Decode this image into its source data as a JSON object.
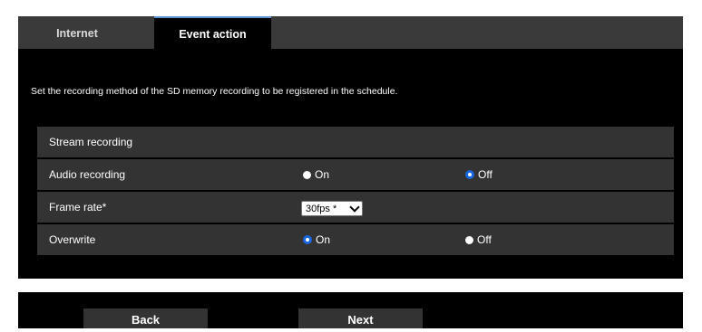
{
  "tabs": [
    {
      "label": "Internet",
      "active": false
    },
    {
      "label": "Event action",
      "active": true
    }
  ],
  "description": "Set the recording method of the SD memory recording to be registered in the schedule.",
  "section_title": "Stream recording",
  "audio_recording": {
    "label": "Audio recording",
    "options": [
      "On",
      "Off"
    ],
    "selected": "Off"
  },
  "frame_rate": {
    "label": "Frame rate*",
    "value": "30fps *"
  },
  "overwrite": {
    "label": "Overwrite",
    "options": [
      "On",
      "Off"
    ],
    "selected": "On"
  },
  "buttons": {
    "back": "Back",
    "next": "Next"
  },
  "colors": {
    "accent": "#5b95d6",
    "radio_selected": "#1a66e0",
    "panel": "#000000",
    "row": "#333333"
  }
}
